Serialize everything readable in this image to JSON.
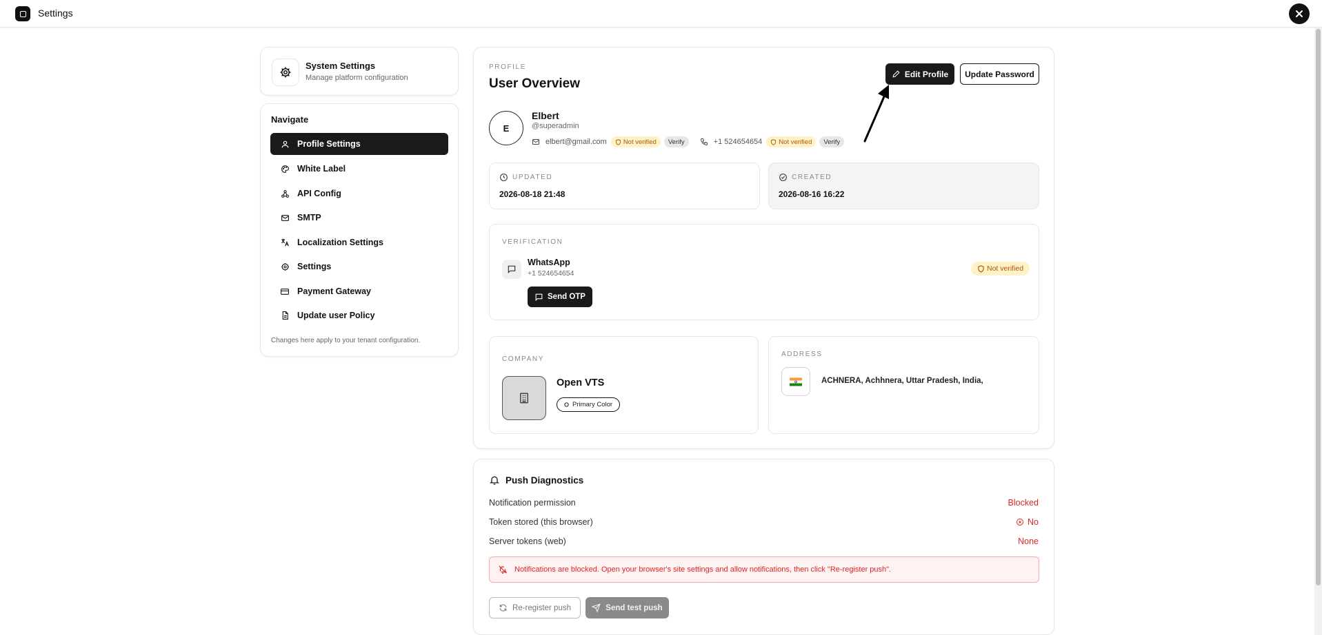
{
  "window": {
    "title": "Settings"
  },
  "sidebar": {
    "header": {
      "title": "System Settings",
      "subtitle": "Manage platform configuration"
    },
    "nav_title": "Navigate",
    "items": [
      {
        "label": "Profile Settings",
        "icon": "user-icon",
        "active": true
      },
      {
        "label": "White Label",
        "icon": "palette-icon"
      },
      {
        "label": "API Config",
        "icon": "webhook-icon"
      },
      {
        "label": "SMTP",
        "icon": "mail-icon"
      },
      {
        "label": "Localization Settings",
        "icon": "languages-icon"
      },
      {
        "label": "Settings",
        "icon": "gear-icon"
      },
      {
        "label": "Payment Gateway",
        "icon": "credit-card-icon"
      },
      {
        "label": "Update user Policy",
        "icon": "document-icon"
      }
    ],
    "footer": "Changes here apply to your tenant configuration."
  },
  "profile": {
    "kicker": "PROFILE",
    "title": "User Overview",
    "edit_label": "Edit Profile",
    "password_label": "Update Password",
    "user": {
      "initial": "E",
      "name": "Elbert",
      "handle": "@superadmin",
      "email": "elbert@gmail.com",
      "phone": "+1 524654654",
      "not_verified": "Not verified",
      "verify": "Verify"
    },
    "updated": {
      "label": "UPDATED",
      "value": "2026-08-18 21:48"
    },
    "created": {
      "label": "CREATED",
      "value": "2026-08-16 16:22"
    },
    "verification": {
      "label": "VERIFICATION",
      "channel": "WhatsApp",
      "phone": "+1 524654654",
      "status": "Not verified",
      "send_otp": "Send OTP"
    },
    "company": {
      "label": "COMPANY",
      "name": "Open VTS",
      "pill": "Primary Color"
    },
    "address": {
      "label": "ADDRESS",
      "value": "ACHNERA, Achhnera, Uttar Pradesh, India,"
    }
  },
  "push": {
    "title": "Push Diagnostics",
    "rows": [
      {
        "label": "Notification permission",
        "value": "Blocked"
      },
      {
        "label": "Token stored (this browser)",
        "value": "No"
      },
      {
        "label": "Server tokens (web)",
        "value": "None"
      }
    ],
    "alert": "Notifications are blocked. Open your browser's site settings and allow notifications, then click \"Re-register push\".",
    "reregister": "Re-register push",
    "send_test": "Send test push"
  },
  "colors": {
    "accent": "#1a1a1a",
    "danger": "#dc2626",
    "warn_bg": "#fef3c7",
    "warn_text": "#b45309"
  }
}
